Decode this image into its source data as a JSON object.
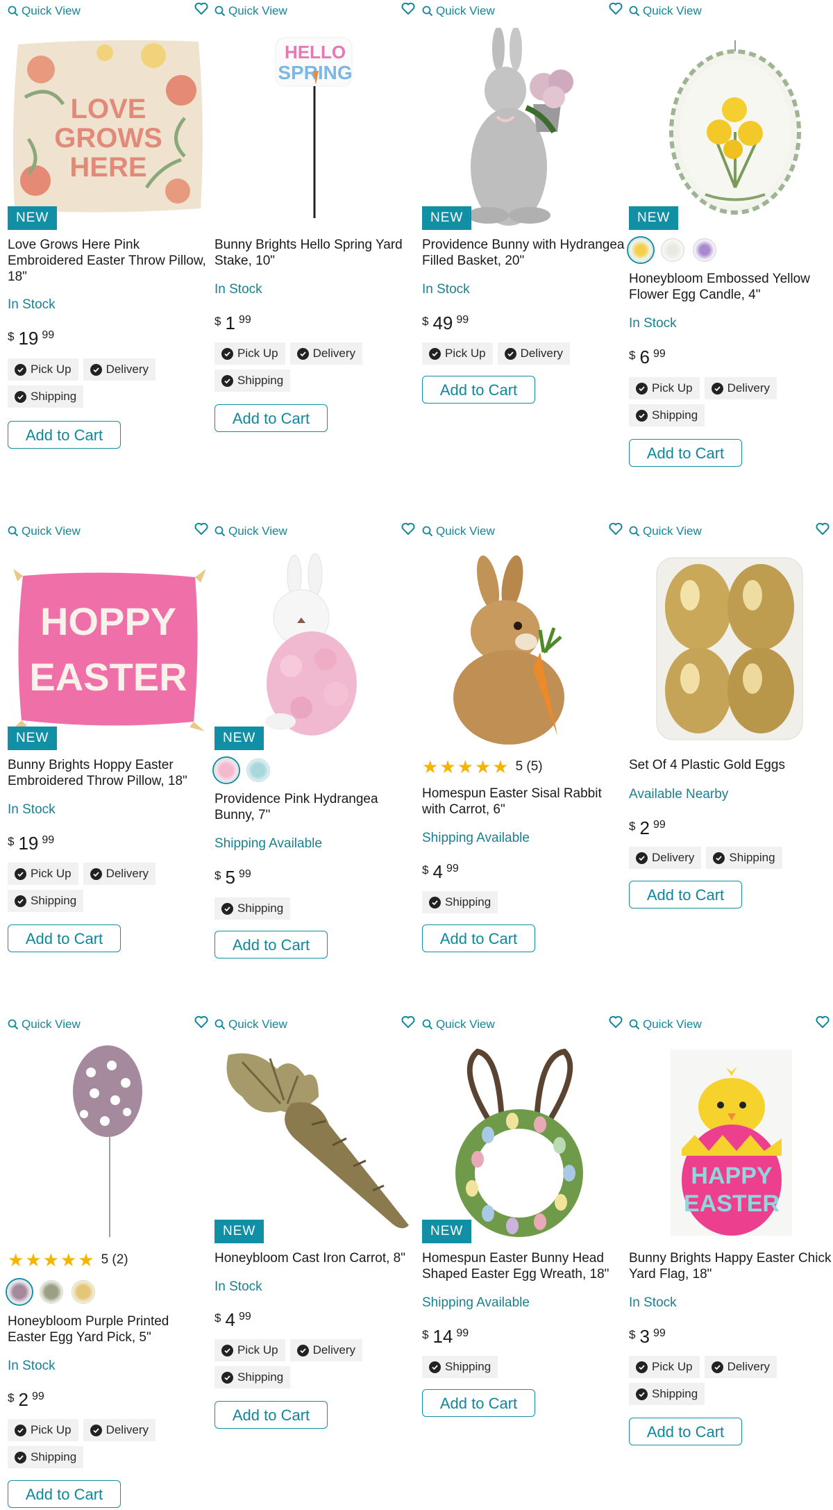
{
  "common": {
    "quick_view": "Quick View",
    "add_to_cart": "Add to Cart",
    "new_badge": "NEW",
    "currency": "$",
    "fulfillment": {
      "pickup": "Pick Up",
      "delivery": "Delivery",
      "shipping": "Shipping"
    }
  },
  "colors": {
    "accent": "#1190a5",
    "stock_text": "#1b7f8f",
    "star": "#f5b400",
    "chip_bg": "#f1f1f1"
  },
  "products": [
    {
      "title": "Love Grows Here Pink Embroidered Easter Throw Pillow, 18\"",
      "availability": "In Stock",
      "price_dollars": "19",
      "price_cents": "99",
      "is_new": true,
      "image_icon": "pillow-love-grows-here-image"
    },
    {
      "title": "Bunny Brights Hello Spring Yard Stake, 10\"",
      "availability": "In Stock",
      "price_dollars": "1",
      "price_cents": "99",
      "is_new": false,
      "image_icon": "hello-spring-stake-image"
    },
    {
      "title": "Providence Bunny with Hydrangea Filled Basket, 20\"",
      "availability": "In Stock",
      "price_dollars": "49",
      "price_cents": "99",
      "is_new": true,
      "image_icon": "bunny-statue-image"
    },
    {
      "title": "Honeybloom Embossed Yellow Flower Egg Candle, 4\"",
      "availability": "In Stock",
      "price_dollars": "6",
      "price_cents": "99",
      "is_new": true,
      "image_icon": "egg-candle-image"
    },
    {
      "title": "Bunny Brights Hoppy Easter Embroidered Throw Pillow, 18\"",
      "availability": "In Stock",
      "price_dollars": "19",
      "price_cents": "99",
      "is_new": true,
      "image_icon": "hoppy-easter-pillow-image"
    },
    {
      "title": "Providence Pink Hydrangea Bunny, 7\"",
      "availability": "Shipping Available",
      "price_dollars": "5",
      "price_cents": "99",
      "is_new": true,
      "image_icon": "pink-hydrangea-bunny-image"
    },
    {
      "title": "Homespun Easter Sisal Rabbit with Carrot, 6\"",
      "availability": "Shipping Available",
      "price_dollars": "4",
      "price_cents": "99",
      "is_new": false,
      "rating": 5,
      "rating_text": "5 (5)",
      "image_icon": "sisal-rabbit-image"
    },
    {
      "title": "Set Of 4 Plastic Gold Eggs",
      "availability": "Available Nearby",
      "price_dollars": "2",
      "price_cents": "99",
      "is_new": false,
      "image_icon": "gold-eggs-image"
    },
    {
      "title": "Honeybloom Purple Printed Easter Egg Yard Pick, 5\"",
      "availability": "In Stock",
      "price_dollars": "2",
      "price_cents": "99",
      "is_new": false,
      "rating": 5,
      "rating_text": "5 (2)",
      "image_icon": "egg-yard-pick-image"
    },
    {
      "title": "Honeybloom Cast Iron Carrot, 8\"",
      "availability": "In Stock",
      "price_dollars": "4",
      "price_cents": "99",
      "is_new": true,
      "image_icon": "cast-iron-carrot-image"
    },
    {
      "title": "Homespun Easter Bunny Head Shaped Easter Egg Wreath, 18\"",
      "availability": "Shipping Available",
      "price_dollars": "14",
      "price_cents": "99",
      "is_new": true,
      "image_icon": "bunny-wreath-image"
    },
    {
      "title": "Bunny Brights Happy Easter Chick Yard Flag, 18\"",
      "availability": "In Stock",
      "price_dollars": "3",
      "price_cents": "99",
      "is_new": false,
      "image_icon": "chick-yard-flag-image"
    }
  ]
}
